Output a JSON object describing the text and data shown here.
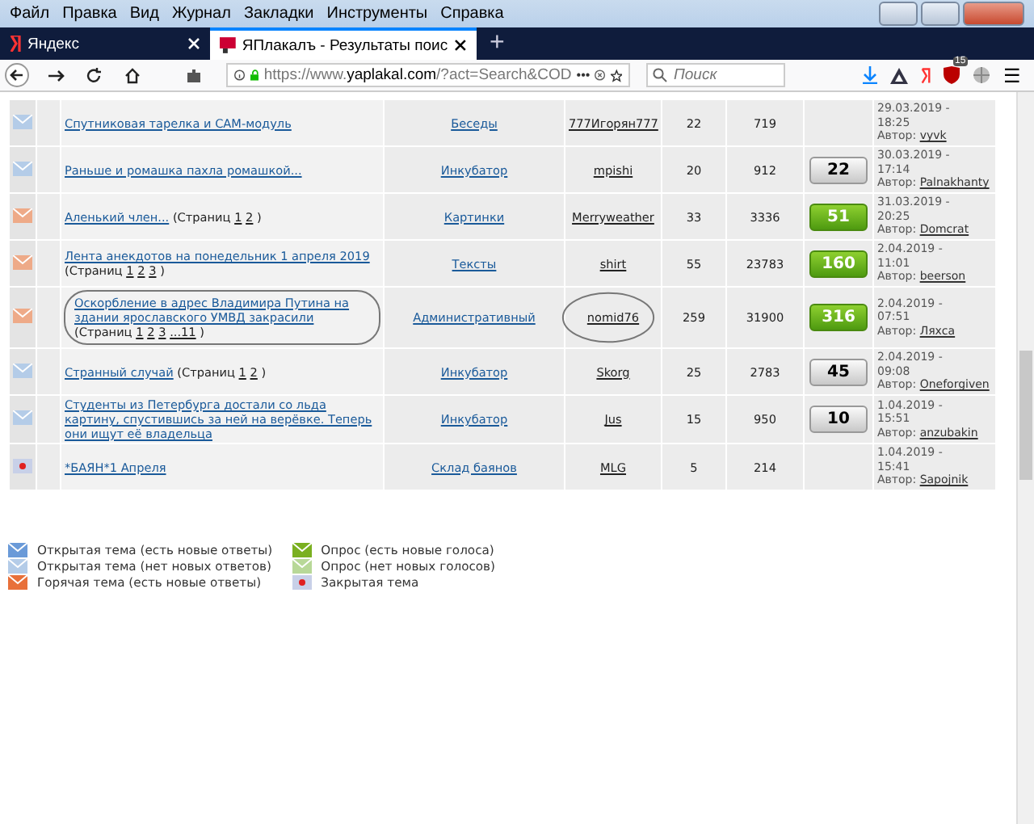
{
  "menu": [
    "Файл",
    "Правка",
    "Вид",
    "Журнал",
    "Закладки",
    "Инструменты",
    "Справка"
  ],
  "tabs": [
    {
      "label": "Яндекс",
      "selected": false
    },
    {
      "label": "ЯПлакалъ - Результаты поис",
      "selected": true
    }
  ],
  "new_tab": "+",
  "address": {
    "prefix": "https://www.",
    "domain": "yaplakal.com",
    "rest": "/?act=Search&COD",
    "more": "•••"
  },
  "search": {
    "placeholder": "Поиск"
  },
  "toolbar_badge": "15",
  "menu_button": "☰",
  "rows": [
    {
      "kind": "no_new",
      "title": "Спутниковая тарелка и CAM-модуль",
      "forum": "Беседы",
      "author": "777Игорян777",
      "replies": "22",
      "views": "719",
      "date": "29.03.2019 -",
      "time": "18:25",
      "by": "Автор:",
      "last": "vyvk"
    },
    {
      "kind": "no_new",
      "title": "Раньше и ромашка пахла ромашкой...",
      "forum": "Инкубатор",
      "author": "mpishi",
      "replies": "20",
      "views": "912",
      "badge": {
        "value": "22",
        "kind": "grey"
      },
      "date": "30.03.2019 -",
      "time": "17:14",
      "by": "Автор:",
      "last": "Palnakhanty"
    },
    {
      "kind": "hot",
      "title": "Аленький член...",
      "pages_label": "(Страниц",
      "pages": [
        "1",
        "2"
      ],
      "pages_end": ")",
      "forum": "Картинки",
      "author": "Merryweather",
      "replies": "33",
      "views": "3336",
      "badge": {
        "value": "51",
        "kind": "green"
      },
      "date": "31.03.2019 -",
      "time": "20:25",
      "by": "Автор:",
      "last": "Domcrat"
    },
    {
      "kind": "hot",
      "title": "Лента анекдотов на понедельник 1 апреля 2019",
      "pages_label": "(Страниц",
      "pages": [
        "1",
        "2",
        "3"
      ],
      "pages_end": ")",
      "forum": "Тексты",
      "author": "shirt",
      "replies": "55",
      "views": "23783",
      "badge": {
        "value": "160",
        "kind": "green"
      },
      "date": "2.04.2019 -",
      "time": "11:01",
      "by": "Автор:",
      "last": "beerson"
    },
    {
      "kind": "hot",
      "title": "Оскорбление в адрес Владимира Путина на здании ярославского УМВД закрасили",
      "pages_label": "(Страниц",
      "pages": [
        "1",
        "2",
        "3",
        "...11"
      ],
      "pages_end": ")",
      "forum": "Административный",
      "author": "nomid76",
      "circled": true,
      "replies": "259",
      "views": "31900",
      "badge": {
        "value": "316",
        "kind": "green"
      },
      "date": "2.04.2019 -",
      "time": "07:51",
      "by": "Автор:",
      "last": "Ляхса"
    },
    {
      "kind": "no_new",
      "title": "Странный случай",
      "pages_label": "(Страниц",
      "pages": [
        "1",
        "2"
      ],
      "pages_end": ")",
      "forum": "Инкубатор",
      "author": "Skorg",
      "replies": "25",
      "views": "2783",
      "badge": {
        "value": "45",
        "kind": "grey"
      },
      "date": "2.04.2019 -",
      "time": "09:08",
      "by": "Автор:",
      "last": "Oneforgiven"
    },
    {
      "kind": "no_new",
      "title": "Студенты из Петербурга достали со льда картину, спустившись за ней на верёвке. Теперь они ищут её владельца",
      "forum": "Инкубатор",
      "author": "Jus",
      "replies": "15",
      "views": "950",
      "badge": {
        "value": "10",
        "kind": "grey"
      },
      "date": "1.04.2019 -",
      "time": "15:51",
      "by": "Автор:",
      "last": "anzubakin"
    },
    {
      "kind": "closed",
      "title": "*БАЯН*1 Апреля",
      "forum": "Склад баянов",
      "author": "MLG",
      "replies": "5",
      "views": "214",
      "date": "1.04.2019 -",
      "time": "15:41",
      "by": "Автор:",
      "last": "Sapojnik"
    }
  ],
  "legend": [
    {
      "kind": "new",
      "label": "Открытая тема (есть новые ответы)"
    },
    {
      "kind": "poll_new",
      "label": "Опрос (есть новые голоса)"
    },
    {
      "kind": "no_new",
      "label": "Открытая тема (нет новых ответов)"
    },
    {
      "kind": "poll",
      "label": "Опрос (нет новых голосов)"
    },
    {
      "kind": "hot_new",
      "label": "Горячая тема (есть новые ответы)"
    },
    {
      "kind": "closed",
      "label": "Закрытая тема"
    }
  ]
}
